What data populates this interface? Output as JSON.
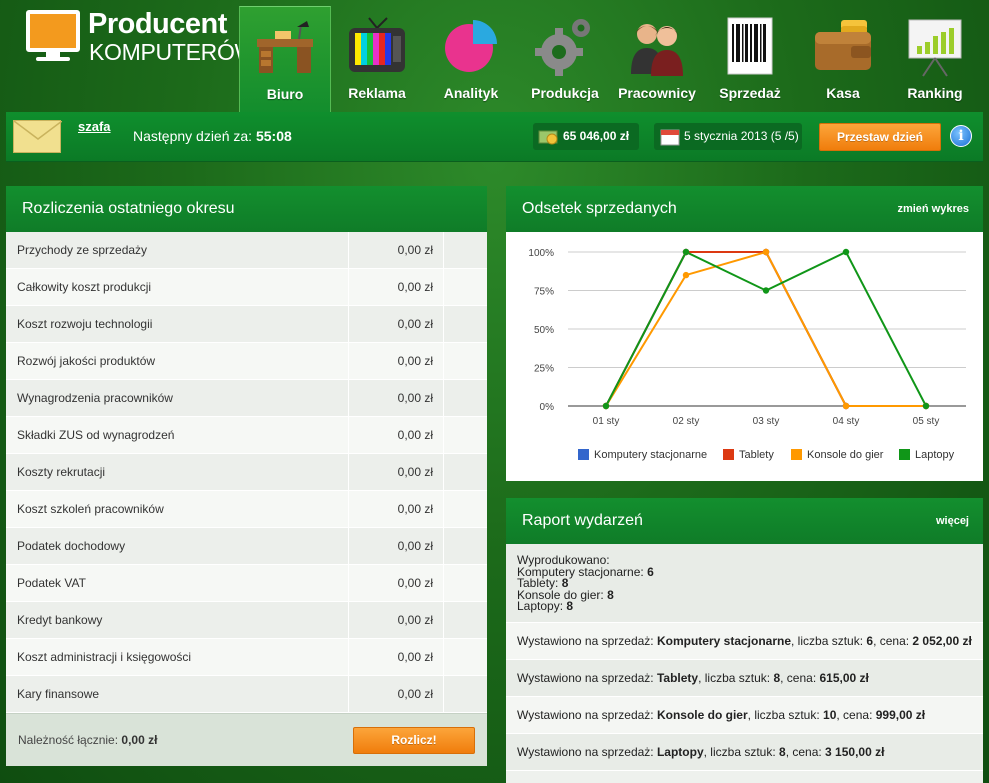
{
  "logo": {
    "line1": "Producent",
    "line2": "KOMPUTERÓW"
  },
  "nav": [
    {
      "label": "Biuro",
      "icon": "desk-icon",
      "active": true
    },
    {
      "label": "Reklama",
      "icon": "tv-icon"
    },
    {
      "label": "Analityk",
      "icon": "pie-chart-icon"
    },
    {
      "label": "Produkcja",
      "icon": "gears-icon"
    },
    {
      "label": "Pracownicy",
      "icon": "people-icon"
    },
    {
      "label": "Sprzedaż",
      "icon": "barcode-icon"
    },
    {
      "label": "Kasa",
      "icon": "wallet-icon"
    },
    {
      "label": "Ranking",
      "icon": "ranking-board-icon"
    }
  ],
  "status": {
    "user": "szafa",
    "next_day_label": "Następny dzień za:",
    "next_day_time": "55:08",
    "money": "65 046,00 zł",
    "date": "5 stycznia 2013 (5 /5)",
    "next_day_button": "Przestaw dzień",
    "info_icon": "info-icon"
  },
  "settlement": {
    "title": "Rozliczenia ostatniego okresu",
    "rows": [
      {
        "label": "Przychody ze sprzedaży",
        "value": "0,00 zł"
      },
      {
        "label": "Całkowity koszt produkcji",
        "value": "0,00 zł"
      },
      {
        "label": "Koszt rozwoju technologii",
        "value": "0,00 zł"
      },
      {
        "label": "Rozwój jakości produktów",
        "value": "0,00 zł"
      },
      {
        "label": "Wynagrodzenia pracowników",
        "value": "0,00 zł"
      },
      {
        "label": "Składki ZUS od wynagrodzeń",
        "value": "0,00 zł"
      },
      {
        "label": "Koszty rekrutacji",
        "value": "0,00 zł"
      },
      {
        "label": "Koszt szkoleń pracowników",
        "value": "0,00 zł"
      },
      {
        "label": "Podatek dochodowy",
        "value": "0,00 zł"
      },
      {
        "label": "Podatek VAT",
        "value": "0,00 zł"
      },
      {
        "label": "Kredyt bankowy",
        "value": "0,00 zł"
      },
      {
        "label": "Koszt administracji i księgowości",
        "value": "0,00 zł"
      },
      {
        "label": "Kary finansowe",
        "value": "0,00 zł"
      }
    ],
    "total_label": "Należność łącznie:",
    "total_value": "0,00 zł",
    "settle_button": "Rozlicz!"
  },
  "sales_chart": {
    "title": "Odsetek sprzedanych",
    "change_link": "zmień wykres"
  },
  "chart_data": {
    "type": "line",
    "x": [
      "01 sty",
      "02 sty",
      "03 sty",
      "04 sty",
      "05 sty"
    ],
    "y_ticks": [
      "100%",
      "75%",
      "50%",
      "25%",
      "0%"
    ],
    "ylim": [
      0,
      100
    ],
    "grid": true,
    "legend_position": "bottom",
    "series": [
      {
        "name": "Komputery stacjonarne",
        "color": "#3366cc",
        "values": [
          0,
          100,
          100,
          0,
          0
        ]
      },
      {
        "name": "Tablety",
        "color": "#dc3912",
        "values": [
          0,
          100,
          100,
          0,
          0
        ]
      },
      {
        "name": "Konsole do gier",
        "color": "#ff9900",
        "values": [
          0,
          85,
          100,
          0,
          0
        ]
      },
      {
        "name": "Laptopy",
        "color": "#109618",
        "values": [
          0,
          100,
          75,
          100,
          0
        ]
      }
    ]
  },
  "events": {
    "title": "Raport wydarzeń",
    "more_link": "więcej",
    "produced_header": "Wyprodukowano:",
    "produced": [
      {
        "label": "Komputery stacjonarne:",
        "value": "6"
      },
      {
        "label": "Tablety:",
        "value": "8"
      },
      {
        "label": "Konsole do gier:",
        "value": "8"
      },
      {
        "label": "Laptopy:",
        "value": "8"
      }
    ],
    "listed_prefix": "Wystawiono na sprzedaż:",
    "qty_label": ", liczba sztuk:",
    "price_label": ", cena:",
    "listings": [
      {
        "product": "Komputery stacjonarne",
        "qty": "6",
        "price": "2 052,00 zł"
      },
      {
        "product": "Tablety",
        "qty": "8",
        "price": "615,00 zł"
      },
      {
        "product": "Konsole do gier",
        "qty": "10",
        "price": "999,00 zł"
      },
      {
        "product": "Laptopy",
        "qty": "8",
        "price": "3 150,00 zł"
      }
    ]
  }
}
